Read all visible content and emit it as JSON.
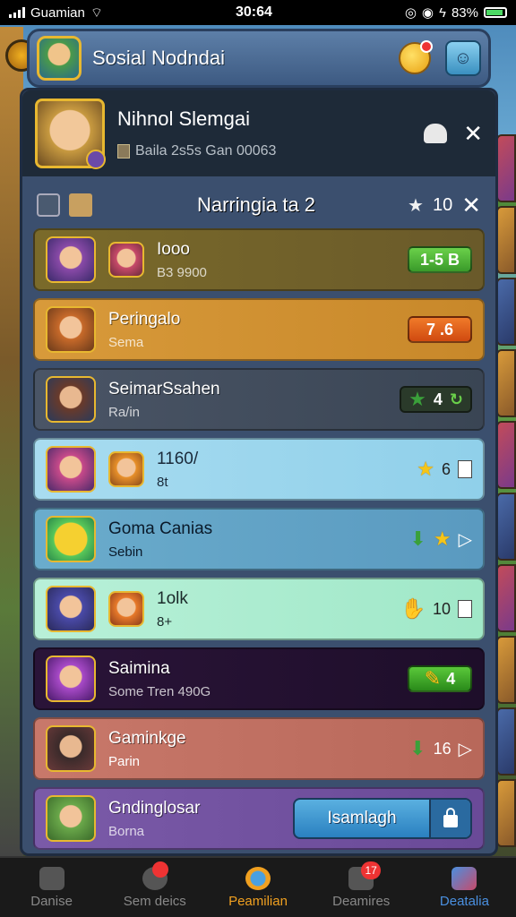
{
  "status_bar": {
    "carrier": "Guamian",
    "time": "30:64",
    "battery": "83%"
  },
  "top_bar": {
    "title": "Sosial Nodndai"
  },
  "profile": {
    "name": "Nihnol Slemgai",
    "subtitle": "Baila 2s5s Gan 00063"
  },
  "section": {
    "title": "Narringia ta 2",
    "star_count": "10"
  },
  "rows": [
    {
      "name": "Iooo",
      "sub": "B3 9900",
      "value": "1-5 B"
    },
    {
      "name": "Peringalo",
      "sub": "Sema",
      "value": "7 .6"
    },
    {
      "name": "SeimarSsahen",
      "sub": "Ra/in",
      "value": "4"
    },
    {
      "name": "1160/",
      "sub": "8t",
      "value": "6"
    },
    {
      "name": "Goma Canias",
      "sub": "Sebin",
      "value": ""
    },
    {
      "name": "1olk",
      "sub": "8+",
      "value": "10"
    },
    {
      "name": "Saimina",
      "sub": "Some Tren 490G",
      "value": "4"
    },
    {
      "name": "Gaminkge",
      "sub": "Parin",
      "value": "16"
    },
    {
      "name": "Gndinglosar",
      "sub": "Borna",
      "button": "Isamlagh"
    }
  ],
  "bottom_nav": {
    "items": [
      {
        "label": "Danise"
      },
      {
        "label": "Sem deics"
      },
      {
        "label": "Peamilian"
      },
      {
        "label": "Deamires",
        "badge": "17"
      },
      {
        "label": "Deatalia"
      }
    ]
  }
}
